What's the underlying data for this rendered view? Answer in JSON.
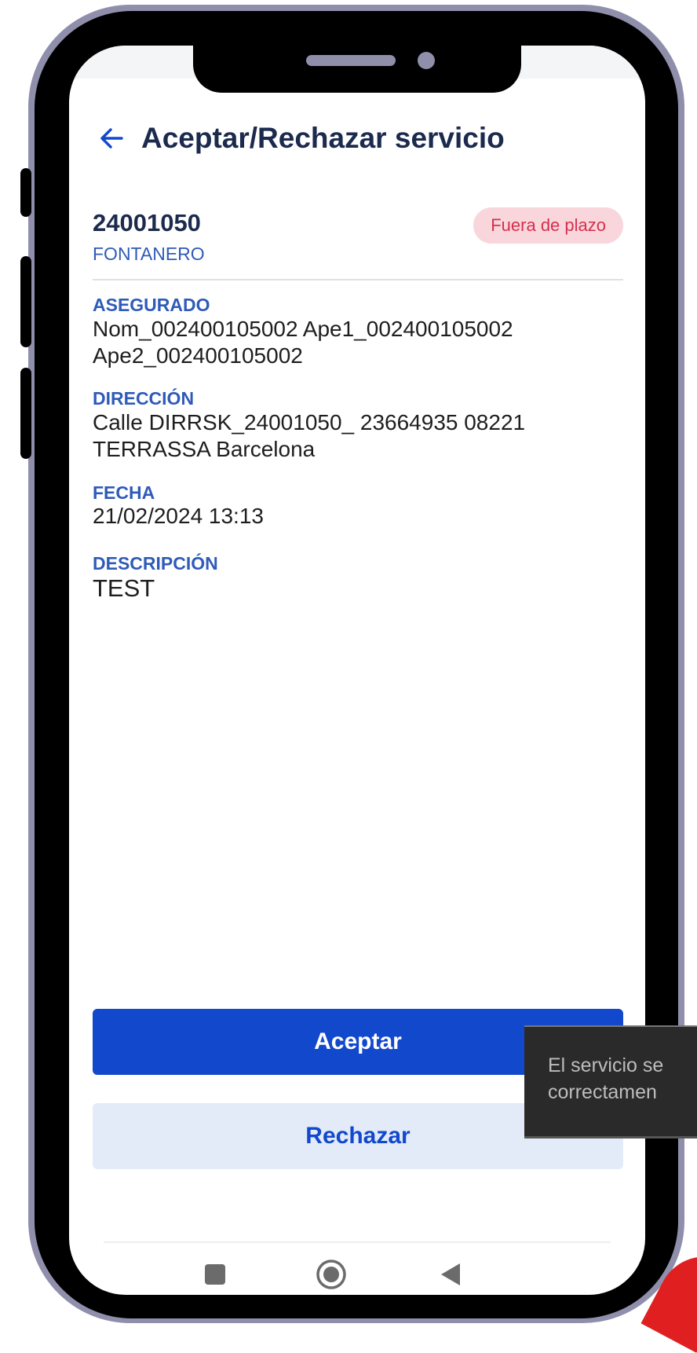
{
  "header": {
    "title": "Aceptar/Rechazar servicio",
    "back_icon": "arrow-left-icon"
  },
  "service": {
    "number": "24001050",
    "trade": "FONTANERO",
    "status_badge": "Fuera de plazo"
  },
  "fields": {
    "insured": {
      "label": "ASEGURADO",
      "value": "Nom_002400105002 Ape1_002400105002 Ape2_002400105002"
    },
    "address": {
      "label": "DIRECCIÓN",
      "value": "Calle DIRRSK_24001050_ 23664935 08221 TERRASSA Barcelona"
    },
    "date": {
      "label": "FECHA",
      "value": "21/02/2024 13:13"
    },
    "description": {
      "label": "DESCRIPCIÓN",
      "value": "TEST"
    }
  },
  "actions": {
    "accept_label": "Aceptar",
    "reject_label": "Rechazar"
  },
  "toast": {
    "line1": "El servicio se",
    "line2": "correctamen"
  },
  "nav": {
    "recents_icon": "square-icon",
    "home_icon": "circle-home-icon",
    "back_icon": "triangle-back-icon"
  },
  "colors": {
    "accent": "#1248cc",
    "title": "#1b2a4d",
    "label": "#2f5bb8",
    "badge_bg": "#f8d6dc",
    "badge_text": "#d6304c",
    "frame": "#8f8fac"
  }
}
